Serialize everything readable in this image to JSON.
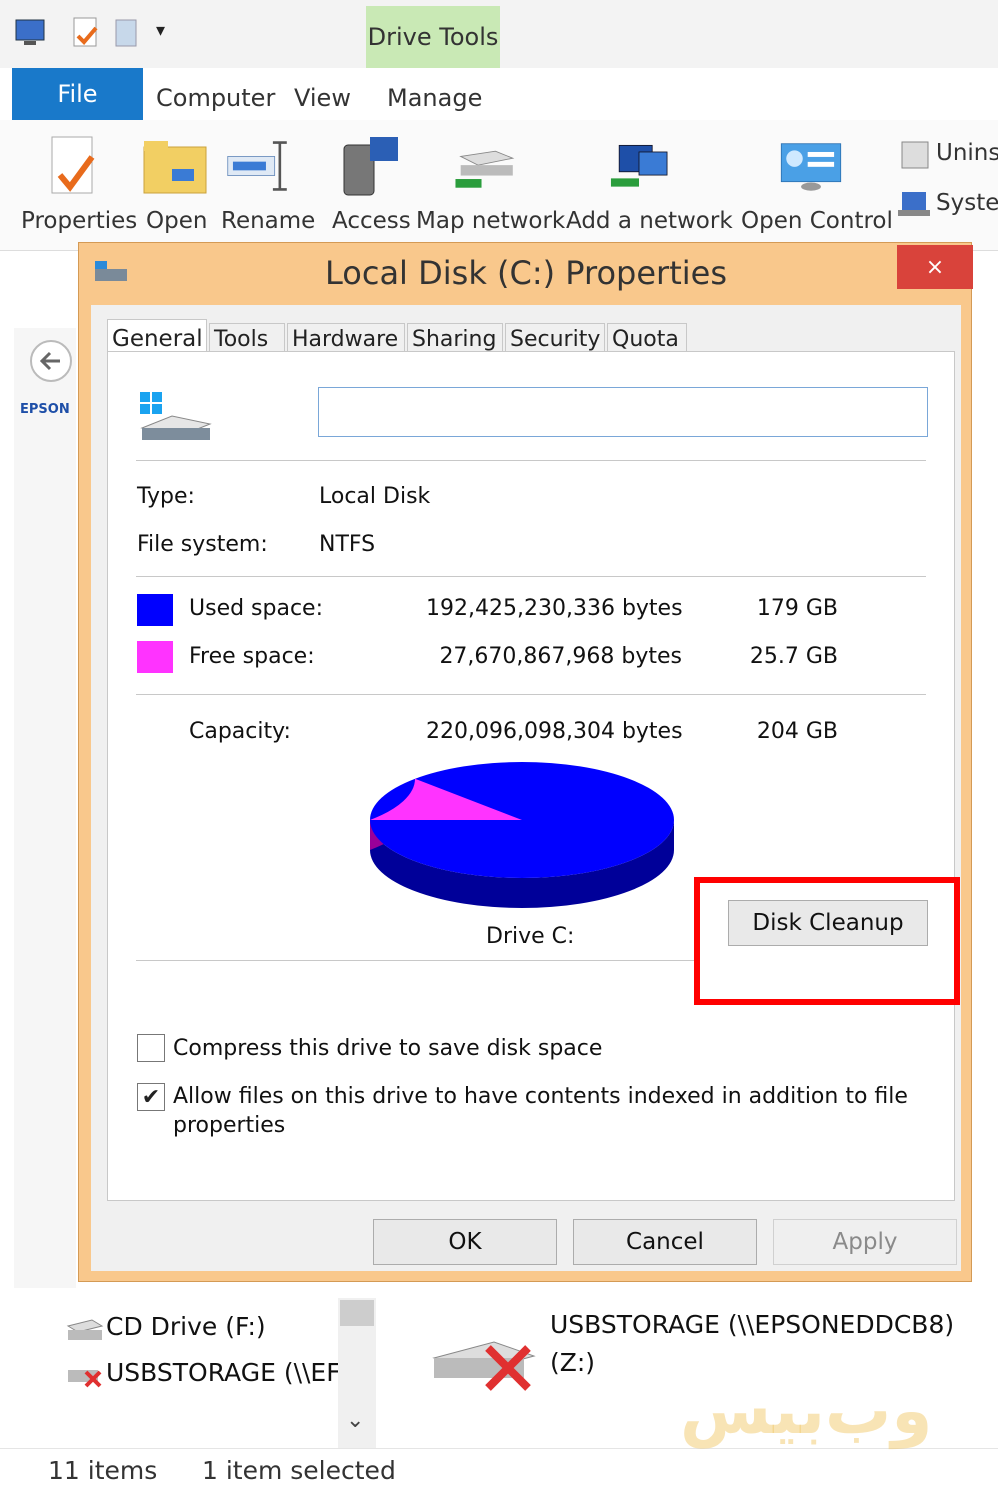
{
  "explorer": {
    "drive_tools_label": "Drive Tools",
    "tabs": {
      "file": "File",
      "computer": "Computer",
      "view": "View",
      "manage": "Manage"
    },
    "ribbon": {
      "properties": "Properties",
      "open": "Open",
      "rename": "Rename",
      "access": "Access",
      "map_network": "Map network",
      "add_network": "Add a network",
      "open_control": "Open Control",
      "uninstall": "Unins",
      "system": "Syster"
    },
    "nav_label": "EPSON",
    "files": {
      "cd_drive": "CD Drive (F:)",
      "usb_short": "USBSTORAGE (\\\\EF",
      "usb_long_line1": "USBSTORAGE (\\\\EPSONEDDCB8)",
      "usb_long_line2": "(Z:)"
    },
    "status": {
      "items": "11 items",
      "selected": "1 item selected"
    },
    "watermark": "وب‌بیس"
  },
  "dialog": {
    "title": "Local Disk (C:) Properties",
    "close_glyph": "×",
    "tabs": [
      "General",
      "Tools",
      "Hardware",
      "Sharing",
      "Security",
      "Quota"
    ],
    "name_field_value": "",
    "type_label": "Type:",
    "type_value": "Local Disk",
    "fs_label": "File system:",
    "fs_value": "NTFS",
    "used_label": "Used space:",
    "used_bytes": "192,425,230,336 bytes",
    "used_size": "179 GB",
    "free_label": "Free space:",
    "free_bytes": "27,670,867,968 bytes",
    "free_size": "25.7 GB",
    "capacity_label": "Capacity:",
    "capacity_bytes": "220,096,098,304 bytes",
    "capacity_size": "204 GB",
    "drive_label": "Drive C:",
    "disk_cleanup": "Disk Cleanup",
    "compress_label": "Compress this drive to save disk space",
    "compress_checked": false,
    "index_label_line1": "Allow files on this drive to have contents indexed in addition to file",
    "index_label_line2": "properties",
    "index_checked": true,
    "ok": "OK",
    "cancel": "Cancel",
    "apply": "Apply"
  },
  "colors": {
    "used": "#0000ff",
    "free": "#ff33ff",
    "file_tab": "#1979ca",
    "drive_tools": "#c9e9b5",
    "dialog_frame": "#f9c88c",
    "close_button": "#d9433b",
    "highlight": "#ff0000"
  },
  "chart_data": {
    "type": "pie",
    "title": "",
    "series": [
      {
        "name": "Used space",
        "value": 192425230336
      },
      {
        "name": "Free space",
        "value": 27670867968
      }
    ]
  }
}
